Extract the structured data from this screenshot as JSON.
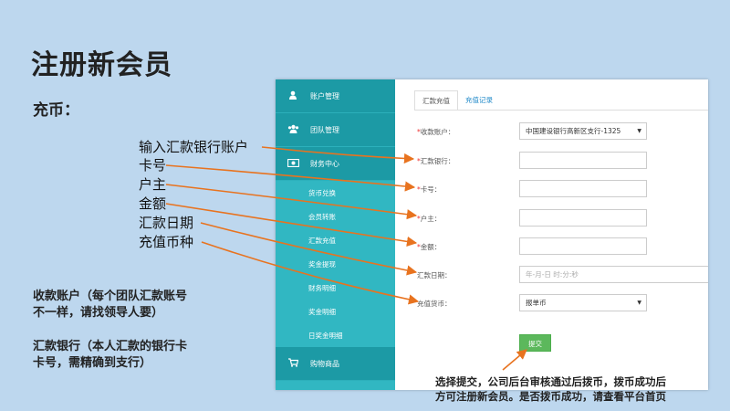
{
  "title": "注册新会员",
  "subtitle": "充币：",
  "annotations": [
    "输入汇款银行账户",
    "卡号",
    "户主",
    "金额",
    "汇款日期",
    "充值币种"
  ],
  "notes": {
    "account_line1": "收款账户（每个团队汇款账号",
    "account_line2": "不一样，请找领导人要）",
    "bank_line1": "汇款银行（本人汇款的银行卡",
    "bank_line2": "卡号，需精确到支行）"
  },
  "sidebar": {
    "main_items": [
      {
        "label": "账户管理",
        "icon": "user-icon"
      },
      {
        "label": "团队管理",
        "icon": "users-icon"
      },
      {
        "label": "财务中心",
        "icon": "money-icon"
      }
    ],
    "sub_items": [
      "货币兑换",
      "会员转账",
      "汇款充值",
      "奖金提现",
      "财务明细",
      "奖金明细",
      "日奖金明细"
    ],
    "shop": {
      "label": "购物商品",
      "icon": "cart-icon"
    }
  },
  "tabs": [
    "汇款充值",
    "充值记录"
  ],
  "form": {
    "account_label": "收款账户：",
    "account_value": "中国建设银行高新区支行-1325",
    "bank_label": "汇款银行：",
    "card_label": "卡号：",
    "holder_label": "户主：",
    "amount_label": "金额：",
    "date_label": "汇款日期：",
    "date_placeholder": "年-月-日 时:分:秒",
    "currency_label": "充值货币：",
    "currency_value": "报单币",
    "submit_label": "提交"
  },
  "bottom_note": {
    "line1": "选择提交，公司后台审核通过后拨币，拨币成功后",
    "line2": "方可注册新会员。是否拨币成功，请查看平台首页"
  },
  "colors": {
    "background": "#bdd7ee",
    "sidebar": "#31b7c2",
    "sidebar_dark": "#1c9aa5",
    "arrow": "#e8731f",
    "submit": "#5cb85c",
    "required": "#ee3333"
  }
}
